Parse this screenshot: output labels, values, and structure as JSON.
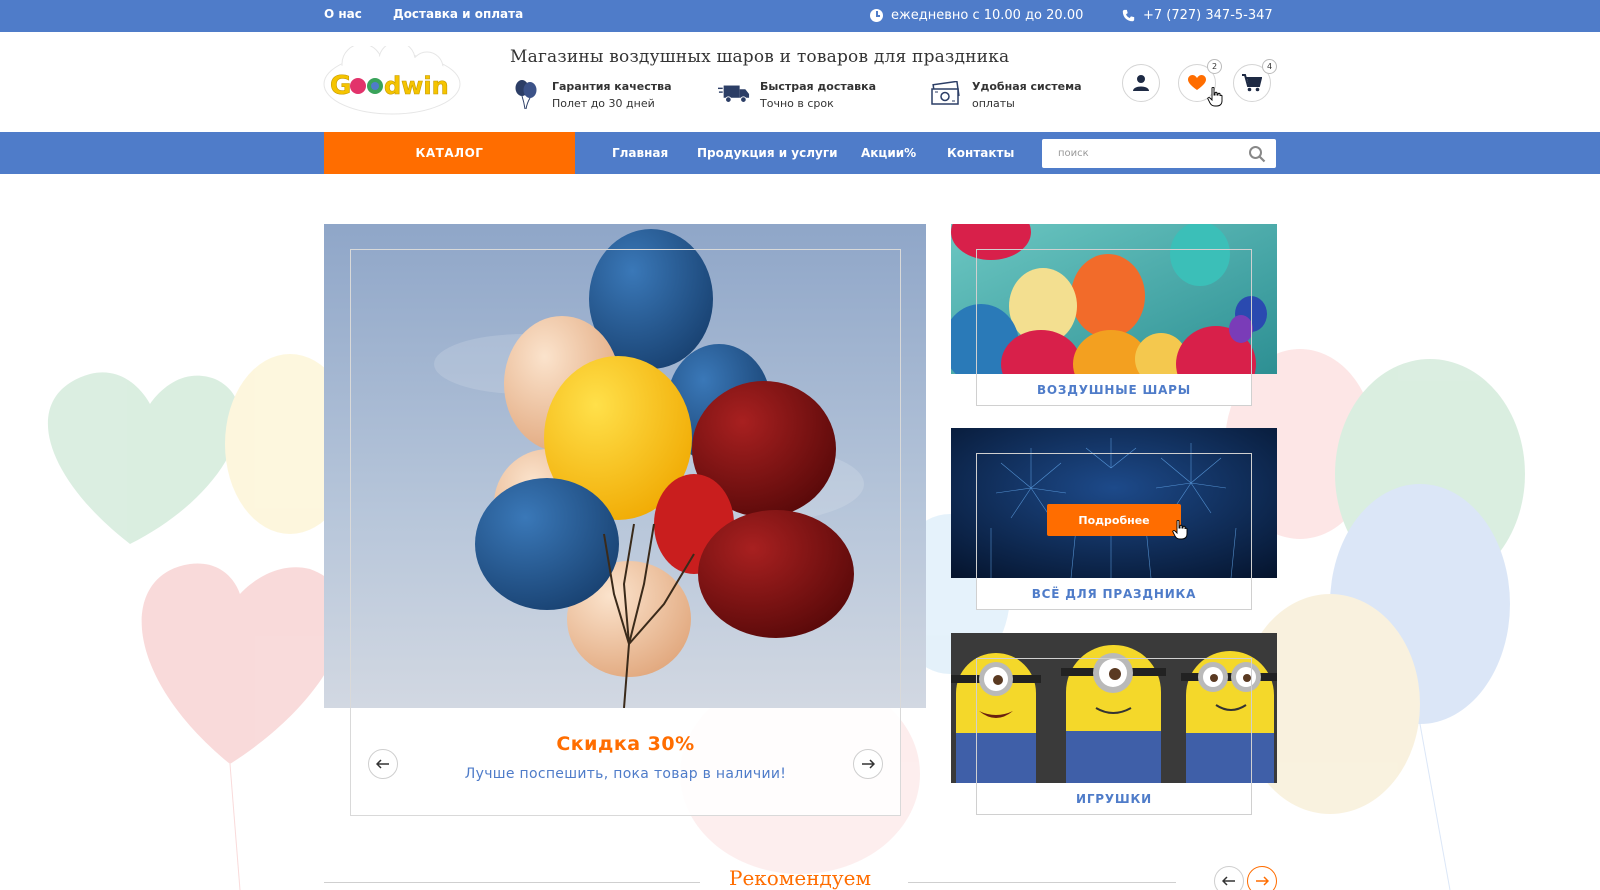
{
  "topbar": {
    "about": "О нас",
    "delivery": "Доставка и оплата",
    "hours": "ежедневно с 10.00 до 20.00",
    "phone": "+7 (727) 347-5-347"
  },
  "header": {
    "logo_text": "Goodwin",
    "tagline": "Магазины воздушных шаров и товаров для праздника",
    "features": [
      {
        "icon": "balloons-icon",
        "title": "Гарантия качества",
        "text": "Полет до 30 дней"
      },
      {
        "icon": "truck-icon",
        "title": "Быстрая доставка",
        "text": "Точно в срок"
      },
      {
        "icon": "money-icon",
        "title": "Удобная система",
        "text": "оплаты"
      }
    ],
    "wishlist_count": "2",
    "cart_count": "4"
  },
  "nav": {
    "catalog": "КАТАЛОГ",
    "links": [
      "Главная",
      "Продукция и услуги",
      "Акции%",
      "Контакты"
    ],
    "search_placeholder": "поиск"
  },
  "hero": {
    "title": "Скидка 30%",
    "subtitle": "Лучше поспешить, пока товар в наличии!"
  },
  "categories": [
    {
      "label": "ВОЗДУШНЫЕ ШАРЫ"
    },
    {
      "label": "ВСЁ ДЛЯ ПРАЗДНИКА",
      "button": "Подробнее"
    },
    {
      "label": "ИГРУШКИ"
    }
  ],
  "recommend": {
    "title": "Рекомендуем"
  },
  "colors": {
    "brand_blue": "#4f7cc9",
    "accent_orange": "#ff6d00"
  }
}
